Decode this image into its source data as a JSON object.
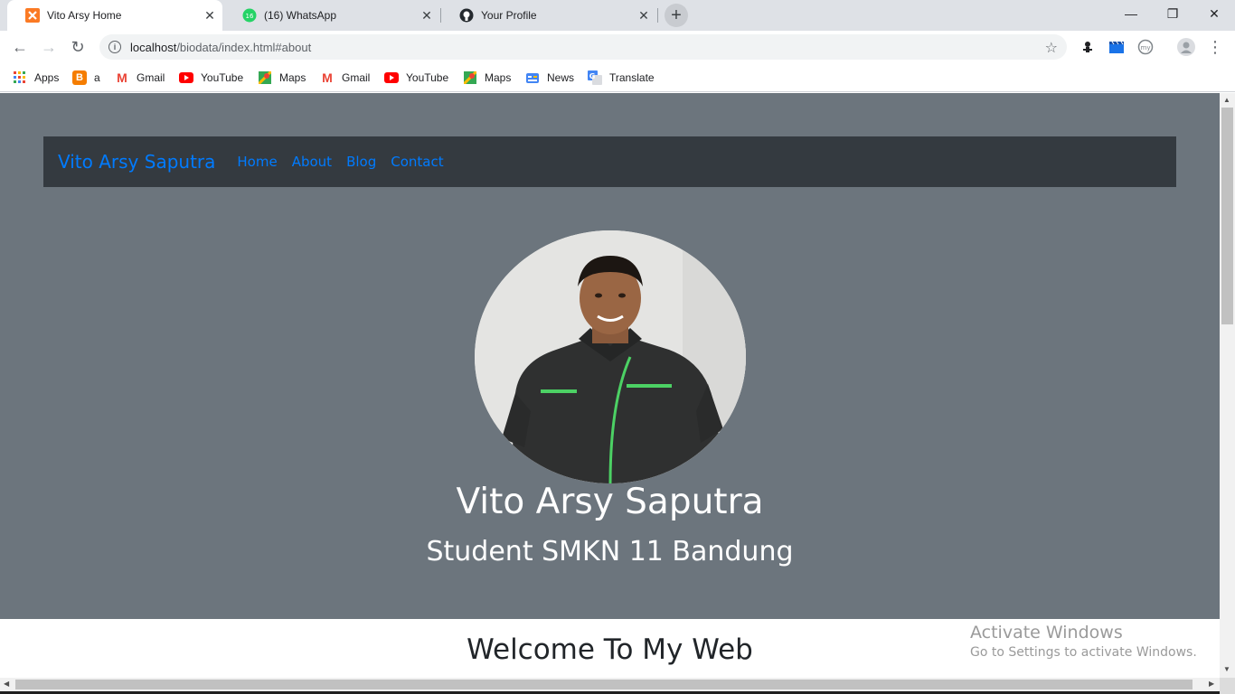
{
  "browser": {
    "tabs": [
      {
        "title": "Vito Arsy Home",
        "icon": "xampp-icon"
      },
      {
        "title": "(16) WhatsApp",
        "icon": "whatsapp-icon",
        "badge": "16"
      },
      {
        "title": "Your Profile",
        "icon": "github-icon"
      }
    ],
    "url_host": "localhost",
    "url_path": "/biodata/index.html#about",
    "bookmarks": [
      {
        "label": "Apps",
        "icon": "apps-grid-icon"
      },
      {
        "label": "a",
        "icon": "blogger-icon"
      },
      {
        "label": "Gmail",
        "icon": "gmail-icon"
      },
      {
        "label": "YouTube",
        "icon": "youtube-icon"
      },
      {
        "label": "Maps",
        "icon": "maps-icon"
      },
      {
        "label": "Gmail",
        "icon": "gmail-icon"
      },
      {
        "label": "YouTube",
        "icon": "youtube-icon"
      },
      {
        "label": "Maps",
        "icon": "maps-icon"
      },
      {
        "label": "News",
        "icon": "news-icon"
      },
      {
        "label": "Translate",
        "icon": "translate-icon"
      }
    ]
  },
  "page": {
    "brand": "Vito Arsy Saputra",
    "nav": [
      {
        "label": "Home"
      },
      {
        "label": "About"
      },
      {
        "label": "Blog"
      },
      {
        "label": "Contact"
      }
    ],
    "hero_name": "Vito Arsy Saputra",
    "hero_subtitle": "Student SMKN 11 Bandung",
    "welcome": "Welcome To My Web"
  },
  "watermark": {
    "line1": "Activate Windows",
    "line2": "Go to Settings to activate Windows."
  },
  "colors": {
    "hero_bg": "#6c757d",
    "navbar_bg": "#343a40",
    "link": "#007bff"
  }
}
